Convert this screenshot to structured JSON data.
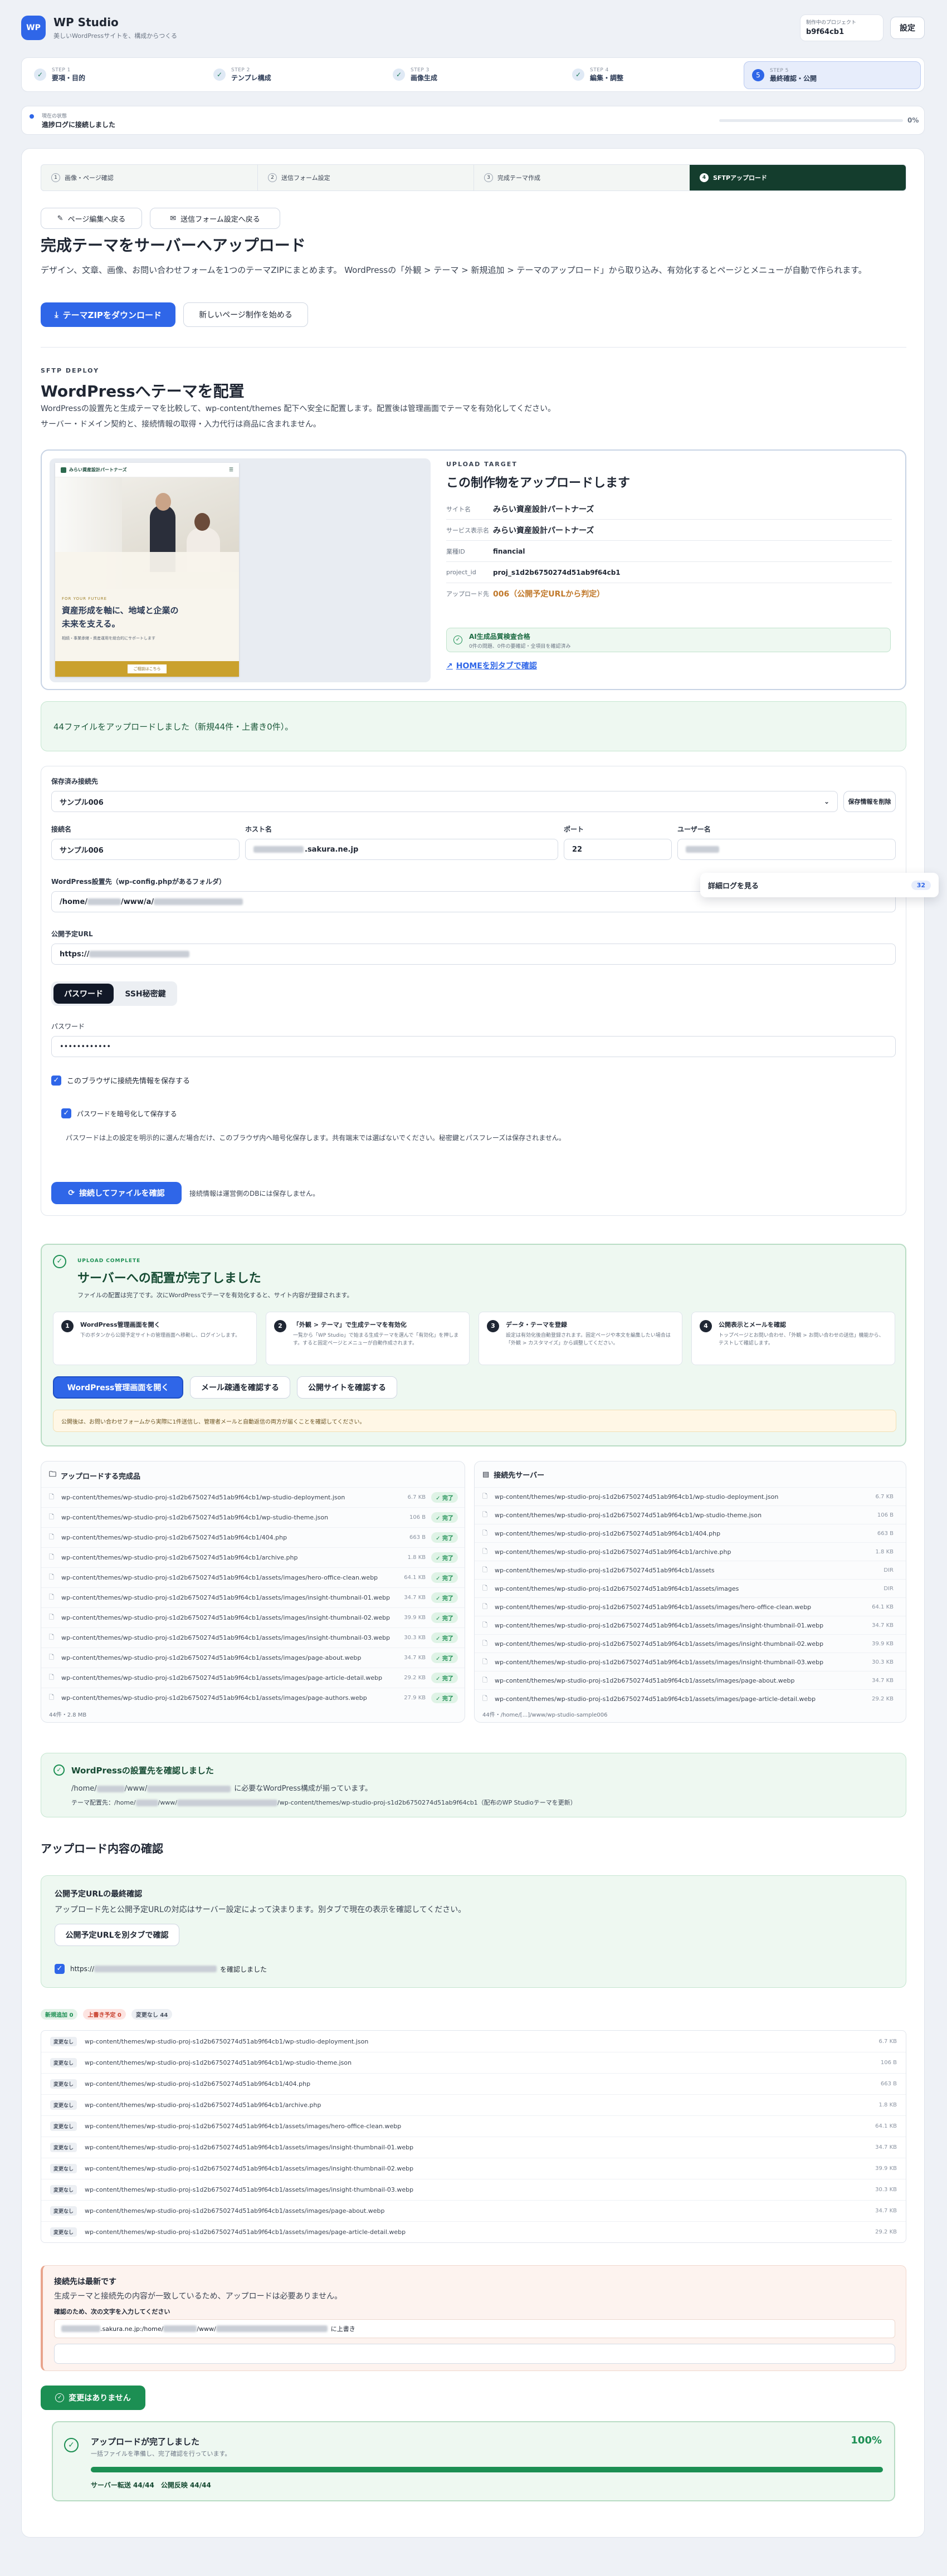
{
  "app": {
    "title": "WP Studio",
    "subtitle": "美しいWordPressサイトを、構成からつくる",
    "logo": "WP"
  },
  "project": {
    "label": "制作中のプロジェクト",
    "id": "b9f64cb1",
    "settings_label": "設定"
  },
  "steps": [
    {
      "sub": "STEP 1",
      "label": "要項・目的"
    },
    {
      "sub": "STEP 2",
      "label": "テンプレ構成"
    },
    {
      "sub": "STEP 3",
      "label": "画像生成"
    },
    {
      "sub": "STEP 4",
      "label": "編集・調整"
    },
    {
      "sub": "STEP 5",
      "label": "最終確認・公開",
      "num": "5"
    }
  ],
  "status": {
    "small": "現在の状態",
    "text": "進捗ログに接続しました",
    "percent": "0%",
    "progress": 0
  },
  "tabs": [
    {
      "n": "1",
      "label": "画像・ページ確認"
    },
    {
      "n": "2",
      "label": "送信フォーム設定"
    },
    {
      "n": "3",
      "label": "完成テーマ作成"
    },
    {
      "n": "4",
      "label": "SFTPアップロード"
    }
  ],
  "nav": {
    "back_edit": "ページ編集へ戻る",
    "back_form": "送信フォーム設定へ戻る"
  },
  "intro": {
    "title": "完成テーマをサーバーへアップロード",
    "desc": "デザイン、文章、画像、お問い合わせフォームを1つのテーマZIPにまとめます。 WordPressの「外観 > テーマ > 新規追加 > テーマのアップロード」から取り込み、有効化するとページとメニューが自動で作られます。",
    "download": "テーマZIPをダウンロード",
    "new_page": "新しいページ制作を始める"
  },
  "deploy": {
    "eyebrow": "SFTP DEPLOY",
    "title": "WordPressへテーマを配置",
    "desc1": "WordPressの設置先と生成テーマを比較して、wp-content/themes 配下へ安全に配置します。配置後は管理画面でテーマを有効化してください。",
    "desc2": "サーバー・ドメイン契約と、接続情報の取得・入力代行は商品に含まれません。"
  },
  "preview": {
    "brand": "みらい資産設計パートナーズ",
    "eyebrow": "FOR YOUR FUTURE",
    "headline1": "資産形成を軸に、地域と企業の",
    "headline2": "未来を支える。",
    "sub": "相続・事業承継・資産運用を総合的にサポートします",
    "cta": "ご相談はこちら"
  },
  "target": {
    "eyebrow": "UPLOAD TARGET",
    "title": "この制作物をアップロードします",
    "rows": [
      {
        "k": "サイト名",
        "v": "みらい資産設計パートナーズ"
      },
      {
        "k": "サービス表示名",
        "v": "みらい資産設計パートナーズ"
      },
      {
        "k": "業種ID",
        "v": "financial"
      },
      {
        "k": "project_id",
        "v": "proj_s1d2b6750274d51ab9f64cb1"
      },
      {
        "k": "アップロード先",
        "v": "006（公開予定URLから判定）"
      }
    ],
    "check_title": "AI生成品質検査合格",
    "check_sub": "0件の問題、0件の要確認・全項目を確認済み",
    "home_link": "HOMEを別タブで確認"
  },
  "upload_notice": "44ファイルをアップロードしました（新規44件・上書き0件）。",
  "form": {
    "saved_label": "保存済み接続先",
    "saved_value": "サンプル006",
    "delete_saved": "保存情報を削除",
    "name_label": "接続名",
    "name_value": "サンプル006",
    "host_label": "ホスト名",
    "host_value": ".sakura.ne.jp",
    "port_label": "ポート",
    "port_value": "22",
    "user_label": "ユーザー名",
    "wp_label": "WordPress設置先（wp-config.phpがあるフォルダ）",
    "wp_value_a": "/home/",
    "wp_value_b": "/www/a/",
    "url_label": "公開予定URL",
    "url_value": "https://",
    "auth_password": "パスワード",
    "auth_ssh": "SSH秘密鍵",
    "pw_label": "パスワード",
    "pw_value": "••••••••••••",
    "save_browser": "このブラウザに接続先情報を保存する",
    "save_encrypted": "パスワードを暗号化して保存する",
    "pw_note": "パスワードは上の設定を明示的に選んだ場合だけ、このブラウザ内へ暗号化保存します。共有端末では選ばないでください。秘密鍵とパスフレーズは保存されません。",
    "connect": "接続してファイルを確認",
    "connect_note": "接続情報は運営側のDBには保存しません。"
  },
  "log": {
    "label": "詳細ログを見る",
    "badge": "32"
  },
  "complete": {
    "eyebrow": "UPLOAD COMPLETE",
    "title": "サーバーへの配置が完了しました",
    "desc": "ファイルの配置は完了です。次にWordPressでテーマを有効化すると、サイト内容が登録されます。",
    "guides": [
      {
        "n": "1",
        "t": "WordPress管理画面を開く",
        "d": "下のボタンから公開予定サイトの管理画面へ移動し、ログインします。"
      },
      {
        "n": "2",
        "t": "「外観 > テーマ」で生成テーマを有効化",
        "d": "一覧から「WP Studio」で始まる生成テーマを選んで「有効化」を押します。すると固定ページとメニューが自動作成されます。"
      },
      {
        "n": "3",
        "t": "データ・テーマを登録",
        "d": "設定は有効化後自動登録されます。固定ページや本文を編集したい場合は「外観 > カスタマイズ」から調整してください。"
      },
      {
        "n": "4",
        "t": "公開表示とメールを確認",
        "d": "トップページとお問い合わせ、「外観 > お問い合わせの送信」機能から、テストして確認します。"
      }
    ],
    "btn_admin": "WordPress管理画面を開く",
    "btn_mail": "メール疎通を確認する",
    "btn_site": "公開サイトを確認する",
    "note": "公開後は、お問い合わせフォームから実際に1件送信し、管理者メールと自動返信の両方が届くことを確認してください。"
  },
  "uploaded": {
    "title": "アップロードする完成品",
    "files": [
      {
        "p": "wp-content/themes/wp-studio-proj-s1d2b6750274d51ab9f64cb1/wp-studio-deployment.json",
        "s": "6.7 KB"
      },
      {
        "p": "wp-content/themes/wp-studio-proj-s1d2b6750274d51ab9f64cb1/wp-studio-theme.json",
        "s": "106 B"
      },
      {
        "p": "wp-content/themes/wp-studio-proj-s1d2b6750274d51ab9f64cb1/404.php",
        "s": "663 B"
      },
      {
        "p": "wp-content/themes/wp-studio-proj-s1d2b6750274d51ab9f64cb1/archive.php",
        "s": "1.8 KB"
      },
      {
        "p": "wp-content/themes/wp-studio-proj-s1d2b6750274d51ab9f64cb1/assets/images/hero-office-clean.webp",
        "s": "64.1 KB"
      },
      {
        "p": "wp-content/themes/wp-studio-proj-s1d2b6750274d51ab9f64cb1/assets/images/insight-thumbnail-01.webp",
        "s": "34.7 KB"
      },
      {
        "p": "wp-content/themes/wp-studio-proj-s1d2b6750274d51ab9f64cb1/assets/images/insight-thumbnail-02.webp",
        "s": "39.9 KB"
      },
      {
        "p": "wp-content/themes/wp-studio-proj-s1d2b6750274d51ab9f64cb1/assets/images/insight-thumbnail-03.webp",
        "s": "30.3 KB"
      },
      {
        "p": "wp-content/themes/wp-studio-proj-s1d2b6750274d51ab9f64cb1/assets/images/page-about.webp",
        "s": "34.7 KB"
      },
      {
        "p": "wp-content/themes/wp-studio-proj-s1d2b6750274d51ab9f64cb1/assets/images/page-article-detail.webp",
        "s": "29.2 KB"
      },
      {
        "p": "wp-content/themes/wp-studio-proj-s1d2b6750274d51ab9f64cb1/assets/images/page-authors.webp",
        "s": "27.9 KB"
      }
    ],
    "done": "完了",
    "footer": "44件・2.8 MB"
  },
  "server": {
    "title": "接続先サーバー",
    "files": [
      {
        "p": "wp-content/themes/wp-studio-proj-s1d2b6750274d51ab9f64cb1/wp-studio-deployment.json",
        "s": "6.7 KB"
      },
      {
        "p": "wp-content/themes/wp-studio-proj-s1d2b6750274d51ab9f64cb1/wp-studio-theme.json",
        "s": "106 B"
      },
      {
        "p": "wp-content/themes/wp-studio-proj-s1d2b6750274d51ab9f64cb1/404.php",
        "s": "663 B"
      },
      {
        "p": "wp-content/themes/wp-studio-proj-s1d2b6750274d51ab9f64cb1/archive.php",
        "s": "1.8 KB"
      },
      {
        "p": "wp-content/themes/wp-studio-proj-s1d2b6750274d51ab9f64cb1/assets",
        "s": "DIR"
      },
      {
        "p": "wp-content/themes/wp-studio-proj-s1d2b6750274d51ab9f64cb1/assets/images",
        "s": "DIR"
      },
      {
        "p": "wp-content/themes/wp-studio-proj-s1d2b6750274d51ab9f64cb1/assets/images/hero-office-clean.webp",
        "s": "64.1 KB"
      },
      {
        "p": "wp-content/themes/wp-studio-proj-s1d2b6750274d51ab9f64cb1/assets/images/insight-thumbnail-01.webp",
        "s": "34.7 KB"
      },
      {
        "p": "wp-content/themes/wp-studio-proj-s1d2b6750274d51ab9f64cb1/assets/images/insight-thumbnail-02.webp",
        "s": "39.9 KB"
      },
      {
        "p": "wp-content/themes/wp-studio-proj-s1d2b6750274d51ab9f64cb1/assets/images/insight-thumbnail-03.webp",
        "s": "30.3 KB"
      },
      {
        "p": "wp-content/themes/wp-studio-proj-s1d2b6750274d51ab9f64cb1/assets/images/page-about.webp",
        "s": "34.7 KB"
      },
      {
        "p": "wp-content/themes/wp-studio-proj-s1d2b6750274d51ab9f64cb1/assets/images/page-article-detail.webp",
        "s": "29.2 KB"
      }
    ],
    "footer": "44件・/home/[...]/www/wp-studio-sample006"
  },
  "verify": {
    "title": "WordPressの設置先を確認しました",
    "line1a": "/home/",
    "line1b": "/www/",
    "line1c": "に必要なWordPress構成が揃っています。",
    "line2a": "テーマ配置先：/home/",
    "line2b": "/www/",
    "line2c": "/wp-content/themes/wp-studio-proj-s1d2b6750274d51ab9f64cb1（配布のWP Studioテーマを更新）"
  },
  "confirm": {
    "title": "アップロード内容の確認",
    "url_title": "公開予定URLの最終確認",
    "url_desc": "アップロード先と公開予定URLの対応はサーバー設定によって決まります。別タブで現在の表示を確認してください。",
    "url_btn": "公開予定URLを別タブで確認",
    "url_check_a": "https://",
    "url_check_b": "を確認しました",
    "chips": [
      {
        "label": "新規追加 0",
        "color": "#e3f2e8",
        "fg": "#1c8f53"
      },
      {
        "label": "上書き予定 0",
        "color": "#fde4e1",
        "fg": "#c8412f"
      },
      {
        "label": "変更なし 44",
        "color": "#eceff3",
        "fg": "#4a5362"
      }
    ],
    "tag": "変更なし",
    "rows": [
      {
        "p": "wp-content/themes/wp-studio-proj-s1d2b6750274d51ab9f64cb1/wp-studio-deployment.json",
        "s": "6.7 KB"
      },
      {
        "p": "wp-content/themes/wp-studio-proj-s1d2b6750274d51ab9f64cb1/wp-studio-theme.json",
        "s": "106 B"
      },
      {
        "p": "wp-content/themes/wp-studio-proj-s1d2b6750274d51ab9f64cb1/404.php",
        "s": "663 B"
      },
      {
        "p": "wp-content/themes/wp-studio-proj-s1d2b6750274d51ab9f64cb1/archive.php",
        "s": "1.8 KB"
      },
      {
        "p": "wp-content/themes/wp-studio-proj-s1d2b6750274d51ab9f64cb1/assets/images/hero-office-clean.webp",
        "s": "64.1 KB"
      },
      {
        "p": "wp-content/themes/wp-studio-proj-s1d2b6750274d51ab9f64cb1/assets/images/insight-thumbnail-01.webp",
        "s": "34.7 KB"
      },
      {
        "p": "wp-content/themes/wp-studio-proj-s1d2b6750274d51ab9f64cb1/assets/images/insight-thumbnail-02.webp",
        "s": "39.9 KB"
      },
      {
        "p": "wp-content/themes/wp-studio-proj-s1d2b6750274d51ab9f64cb1/assets/images/insight-thumbnail-03.webp",
        "s": "30.3 KB"
      },
      {
        "p": "wp-content/themes/wp-studio-proj-s1d2b6750274d51ab9f64cb1/assets/images/page-about.webp",
        "s": "34.7 KB"
      },
      {
        "p": "wp-content/themes/wp-studio-proj-s1d2b6750274d51ab9f64cb1/assets/images/page-article-detail.webp",
        "s": "29.2 KB"
      }
    ]
  },
  "latest": {
    "title": "接続先は最新です",
    "desc": "生成テーマと接続先の内容が一致しているため、アップロードは必要ありません。",
    "confirm_label": "確認のため、次の文字を入力してください",
    "code_a": ".sakura.ne.jp:/home/",
    "code_b": "/www/",
    "code_c": "に上書き"
  },
  "no_changes": "変更はありません",
  "final": {
    "title": "アップロードが完了しました",
    "sub": "一括ファイルを準備し、完了確認を行っています。",
    "percent": "100%",
    "progress": 100,
    "stats": "サーバー転送 44/44　公開反映 44/44"
  }
}
